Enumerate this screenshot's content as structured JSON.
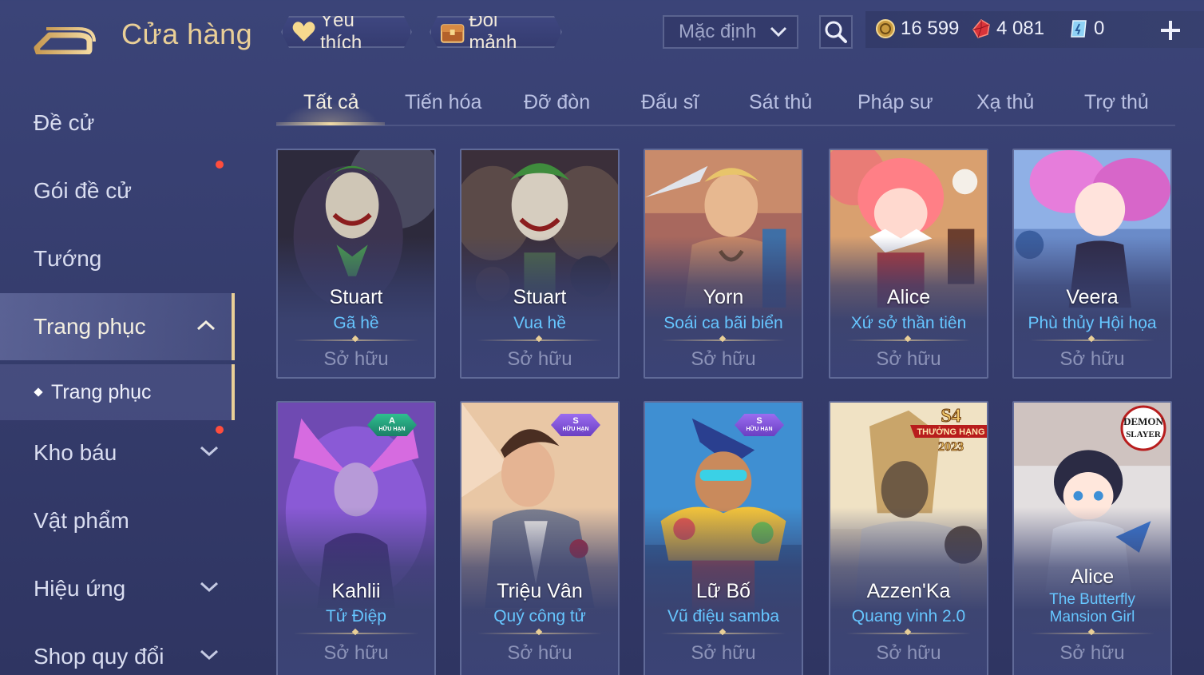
{
  "header": {
    "title": "Cửa hàng",
    "favorite_label": "Yêu thích",
    "shard_label": "Đổi mảnh",
    "sort_value": "Mặc định",
    "currency": {
      "gold": "16 599",
      "ruby": "4 081",
      "ticket": "0"
    },
    "colors": {
      "gold_text": "#e9cf97",
      "skin_name": "#66c6ff",
      "red_dot": "#ff4d3d"
    }
  },
  "sidebar": {
    "items": [
      {
        "label": "Đề cử"
      },
      {
        "label": "Gói đề cử"
      },
      {
        "label": "Tướng"
      },
      {
        "label": "Trang phục"
      },
      {
        "label": "Kho báu"
      },
      {
        "label": "Vật phẩm"
      },
      {
        "label": "Hiệu ứng"
      },
      {
        "label": "Shop quy đổi"
      }
    ],
    "sub_item": "Trang phục"
  },
  "tabs": [
    "Tất cả",
    "Tiến hóa",
    "Đỡ đòn",
    "Đấu sĩ",
    "Sát thủ",
    "Pháp sư",
    "Xạ thủ",
    "Trợ thủ"
  ],
  "cards": [
    {
      "hero": "Stuart",
      "skin": "Gã hề",
      "status": "Sở hữu"
    },
    {
      "hero": "Stuart",
      "skin": "Vua hề",
      "status": "Sở hữu"
    },
    {
      "hero": "Yorn",
      "skin": "Soái ca bãi biển",
      "status": "Sở hữu"
    },
    {
      "hero": "Alice",
      "skin": "Xứ sở thần tiên",
      "status": "Sở hữu"
    },
    {
      "hero": "Veera",
      "skin": "Phù thủy Hội họa",
      "status": "Sở hữu"
    },
    {
      "hero": "Kahlii",
      "skin": "Tử Điệp",
      "status": "Sở hữu",
      "badge": {
        "rank": "A",
        "label": "HỮU HẠN"
      }
    },
    {
      "hero": "Triệu Vân",
      "skin": "Quý công tử",
      "status": "Sở hữu",
      "badge": {
        "rank": "S",
        "label": "HỮU HẠN"
      }
    },
    {
      "hero": "Lữ Bố",
      "skin": "Vũ điệu samba",
      "status": "Sở hữu",
      "badge": {
        "rank": "S",
        "label": "HỮU HẠN"
      }
    },
    {
      "hero": "Azzen'Ka",
      "skin": "Quang vinh 2.0",
      "status": "Sở hữu",
      "logo": {
        "top": "S4",
        "middle": "THƯỞNG HẠNG",
        "bottom": "2023"
      }
    },
    {
      "hero": "Alice",
      "skin": "The Butterfly Mansion Girl",
      "status": "Sở hữu",
      "logo": {
        "top": "DEMON",
        "bottom": "SLAYER"
      }
    }
  ]
}
